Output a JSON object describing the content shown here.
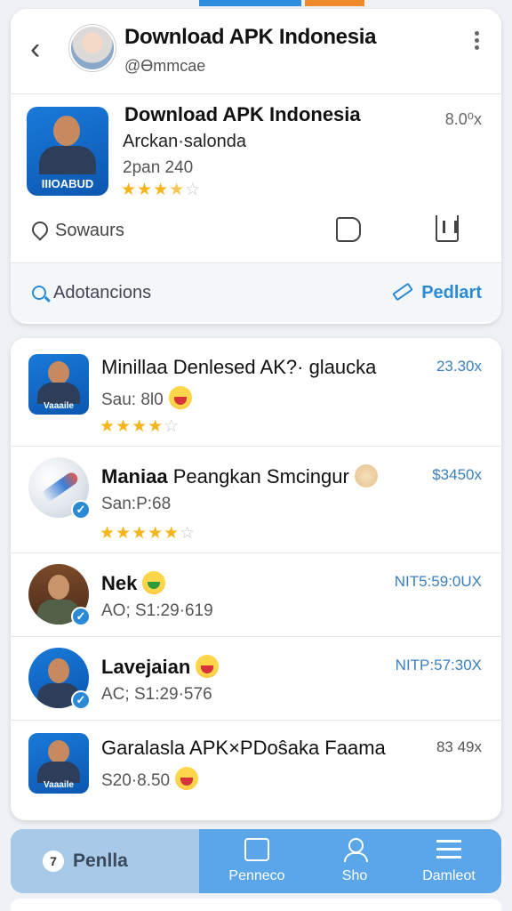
{
  "header": {
    "title": "Download APK Indonesia",
    "handle": "@Ɵmmcae"
  },
  "featured": {
    "title": "Download APK Indonesia",
    "subtitle": "Arckan·salonda",
    "meta": "2pan 240",
    "icon_label": "IIIOABUD",
    "price": "8.0⁰x",
    "rating": 3.5,
    "stars": "★★★★☆",
    "saves_label": "Sowaurs"
  },
  "actions": {
    "advanced_label": "Adotancions",
    "predict_label": "Pedlart"
  },
  "list": [
    {
      "title": "Minillaa Denlesed AK?· glaucka",
      "sub": "Sau: 8l0",
      "stars": "★★★★☆",
      "price": "23.30x",
      "thumb_label": "Vaaaile"
    },
    {
      "title_bold": "Maniaa",
      "title_rest": " Peangkan Smcingur",
      "sub": "San:P:68",
      "stars": "★★★★☆",
      "price": "$3450x"
    },
    {
      "title": "Nek",
      "sub": "AO; S1:29·619",
      "price": "NIT5:59:0UX"
    },
    {
      "title": "Lavejaian",
      "sub": "AC; S1:29·576",
      "price": "NITP:57:30X"
    },
    {
      "title": "Garalasla APK×PDoŝaka Faama",
      "sub": "S20·8.50",
      "price": "83 49x",
      "thumb_label": "Vaaaile"
    }
  ],
  "nav": {
    "badge": "7",
    "left_label": "Penlla",
    "items": [
      "Penneco",
      "Sho",
      "Damleot"
    ]
  },
  "colors": {
    "accent": "#2a8ad6",
    "star": "#f5b51a",
    "nav": "#5aa6e8"
  }
}
